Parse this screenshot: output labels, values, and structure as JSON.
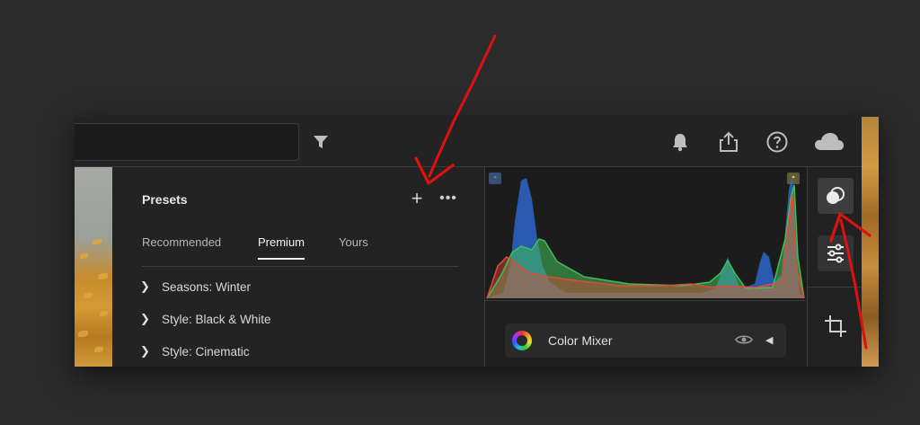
{
  "toolbar": {
    "icons": [
      "filter-icon",
      "bell-icon",
      "share-icon",
      "help-icon",
      "cloud-icon"
    ]
  },
  "presets": {
    "title": "Presets",
    "add_icon": "+",
    "more_icon": "•••",
    "tabs": [
      {
        "label": "Recommended",
        "active": false
      },
      {
        "label": "Premium",
        "active": true
      },
      {
        "label": "Yours",
        "active": false
      }
    ],
    "items": [
      {
        "label": "Seasons: Winter"
      },
      {
        "label": "Style: Black & White"
      },
      {
        "label": "Style: Cinematic"
      }
    ]
  },
  "histogram": {
    "colors": {
      "blue": "#2f6fe0",
      "green": "#3fbf57",
      "red": "#e24a3b",
      "highlight": "#e8c440"
    }
  },
  "color_mixer": {
    "label": "Color Mixer"
  },
  "right_tools": [
    "presets-tool-icon",
    "edit-sliders-icon",
    "crop-icon"
  ],
  "annotation_color": "#e01010"
}
